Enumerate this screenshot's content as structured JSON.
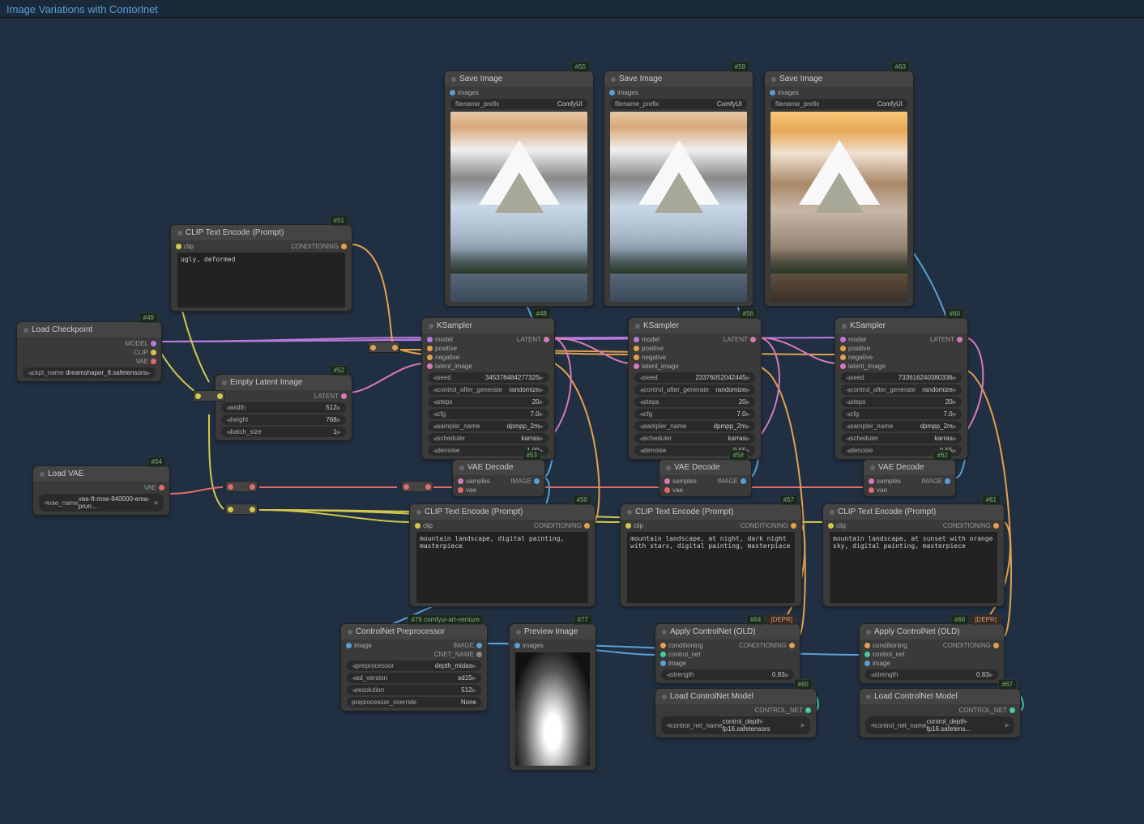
{
  "header": {
    "title": "Image Variations with Contorlnet"
  },
  "nodes": {
    "load_checkpoint": {
      "id": "#49",
      "title": "Load Checkpoint",
      "outputs": [
        "MODEL",
        "CLIP",
        "VAE"
      ],
      "widgets": [
        {
          "label": "ckpt_name",
          "value": "dreamshaper_8.safetensors"
        }
      ]
    },
    "clip_neg": {
      "id": "#51",
      "title": "CLIP Text Encode (Prompt)",
      "inputs": [
        "clip"
      ],
      "outputs": [
        "CONDITIONING"
      ],
      "text": "ugly, deformed"
    },
    "empty_latent": {
      "id": "#52",
      "title": "Empty Latent Image",
      "outputs": [
        "LATENT"
      ],
      "widgets": [
        {
          "label": "width",
          "value": "512"
        },
        {
          "label": "height",
          "value": "768"
        },
        {
          "label": "batch_size",
          "value": "1"
        }
      ]
    },
    "load_vae": {
      "id": "#54",
      "title": "Load VAE",
      "outputs": [
        "VAE"
      ],
      "widgets": [
        {
          "label": "vae_name",
          "value": "vae-ft-mse-840000-ema-prun..."
        }
      ]
    },
    "ksampler_a": {
      "id": "#48",
      "title": "KSampler",
      "inputs": [
        "model",
        "positive",
        "negative",
        "latent_image"
      ],
      "outputs": [
        "LATENT"
      ],
      "widgets": [
        {
          "label": "seed",
          "value": "345378484277325"
        },
        {
          "label": "control_after_generate",
          "value": "randomize"
        },
        {
          "label": "steps",
          "value": "20"
        },
        {
          "label": "cfg",
          "value": "7.0"
        },
        {
          "label": "sampler_name",
          "value": "dpmpp_2m"
        },
        {
          "label": "scheduler",
          "value": "karras"
        },
        {
          "label": "denoise",
          "value": "1.00"
        }
      ]
    },
    "ksampler_b": {
      "id": "#56",
      "title": "KSampler",
      "inputs": [
        "model",
        "positive",
        "negative",
        "latent_image"
      ],
      "outputs": [
        "LATENT"
      ],
      "widgets": [
        {
          "label": "seed",
          "value": "23376052042445"
        },
        {
          "label": "control_after_generate",
          "value": "randomize"
        },
        {
          "label": "steps",
          "value": "20"
        },
        {
          "label": "cfg",
          "value": "7.0"
        },
        {
          "label": "sampler_name",
          "value": "dpmpp_2m"
        },
        {
          "label": "scheduler",
          "value": "karras"
        },
        {
          "label": "denoise",
          "value": "0.55"
        }
      ]
    },
    "ksampler_c": {
      "id": "#60",
      "title": "KSampler",
      "inputs": [
        "model",
        "positive",
        "negative",
        "latent_image"
      ],
      "outputs": [
        "LATENT"
      ],
      "widgets": [
        {
          "label": "seed",
          "value": "733616240380336"
        },
        {
          "label": "control_after_generate",
          "value": "randomize"
        },
        {
          "label": "steps",
          "value": "20"
        },
        {
          "label": "cfg",
          "value": "7.0"
        },
        {
          "label": "sampler_name",
          "value": "dpmpp_2m"
        },
        {
          "label": "scheduler",
          "value": "karras"
        },
        {
          "label": "denoise",
          "value": "0.55"
        }
      ]
    },
    "vae_decode_a": {
      "id": "#53",
      "title": "VAE Decode",
      "inputs": [
        "samples",
        "vae"
      ],
      "outputs": [
        "IMAGE"
      ]
    },
    "vae_decode_b": {
      "id": "#58",
      "title": "VAE Decode",
      "inputs": [
        "samples",
        "vae"
      ],
      "outputs": [
        "IMAGE"
      ]
    },
    "vae_decode_c": {
      "id": "#62",
      "title": "VAE Decode",
      "inputs": [
        "samples",
        "vae"
      ],
      "outputs": [
        "IMAGE"
      ]
    },
    "save_a": {
      "id": "#55",
      "title": "Save Image",
      "inputs": [
        "images"
      ],
      "widgets": [
        {
          "label": "filename_prefix",
          "value": "ComfyUI"
        }
      ]
    },
    "save_b": {
      "id": "#59",
      "title": "Save Image",
      "inputs": [
        "images"
      ],
      "widgets": [
        {
          "label": "filename_prefix",
          "value": "ComfyUI"
        }
      ]
    },
    "save_c": {
      "id": "#63",
      "title": "Save Image",
      "inputs": [
        "images"
      ],
      "widgets": [
        {
          "label": "filename_prefix",
          "value": "ComfyUI"
        }
      ]
    },
    "clip_pos_a": {
      "id": "#50",
      "title": "CLIP Text Encode (Prompt)",
      "inputs": [
        "clip"
      ],
      "outputs": [
        "CONDITIONING"
      ],
      "text": "mountain landscape, digital painting, masterpiece"
    },
    "clip_pos_b": {
      "id": "#57",
      "title": "CLIP Text Encode (Prompt)",
      "inputs": [
        "clip"
      ],
      "outputs": [
        "CONDITIONING"
      ],
      "text": "mountain landscape, at night, dark night with stars, digital painting, masterpiece"
    },
    "clip_pos_c": {
      "id": "#61",
      "title": "CLIP Text Encode (Prompt)",
      "inputs": [
        "clip"
      ],
      "outputs": [
        "CONDITIONING"
      ],
      "text": "mountain landscape, at sunset with orange sky, digital painting, masterpiece"
    },
    "cnet_pre": {
      "id": "#76 comfyui-art-venture",
      "title": "ControlNet Preprocessor",
      "inputs": [
        "image"
      ],
      "outputs": [
        "IMAGE",
        "CNET_NAME"
      ],
      "widgets": [
        {
          "label": "preprocessor",
          "value": "depth_midas"
        },
        {
          "label": "sd_version",
          "value": "sd15"
        },
        {
          "label": "resolution",
          "value": "512"
        },
        {
          "label": "preprocessor_override",
          "value": "None"
        }
      ]
    },
    "preview": {
      "id": "#77",
      "title": "Preview Image",
      "inputs": [
        "images"
      ]
    },
    "apply_cnet_a": {
      "id": "#64",
      "depr": "[DEPR]",
      "title": "Apply ControlNet (OLD)",
      "inputs": [
        "conditioning",
        "control_net",
        "image"
      ],
      "outputs": [
        "CONDITIONING"
      ],
      "widgets": [
        {
          "label": "strength",
          "value": "0.83"
        }
      ]
    },
    "apply_cnet_b": {
      "id": "#66",
      "depr": "[DEPR]",
      "title": "Apply ControlNet (OLD)",
      "inputs": [
        "conditioning",
        "control_net",
        "image"
      ],
      "outputs": [
        "CONDITIONING"
      ],
      "widgets": [
        {
          "label": "strength",
          "value": "0.83"
        }
      ]
    },
    "load_cnet_a": {
      "id": "#65",
      "title": "Load ControlNet Model",
      "outputs": [
        "CONTROL_NET"
      ],
      "widgets": [
        {
          "label": "control_net_name",
          "value": "control_depth-fp16.safetensors"
        }
      ]
    },
    "load_cnet_b": {
      "id": "#67",
      "title": "Load ControlNet Model",
      "outputs": [
        "CONTROL_NET"
      ],
      "widgets": [
        {
          "label": "control_net_name",
          "value": "control_depth-fp16.safetens..."
        }
      ]
    }
  }
}
